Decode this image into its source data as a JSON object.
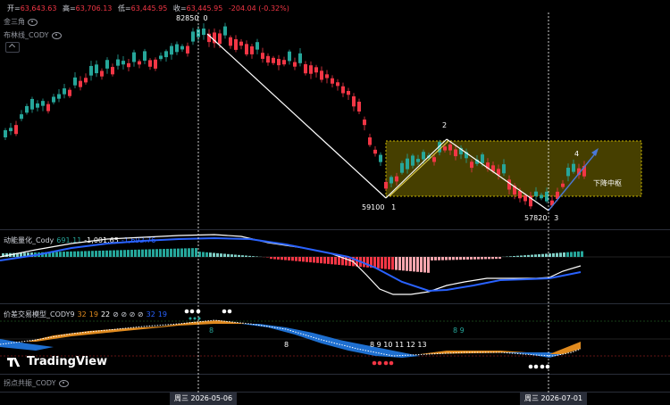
{
  "header": {
    "open_label": "开=",
    "open": "63,643.63",
    "high_label": "高=",
    "high": "63,706.13",
    "low_label": "低=",
    "low": "63,445.95",
    "close_label": "收=",
    "close": "63,445.95",
    "change": "-204.04 (-0.32%)"
  },
  "indicators_main": [
    {
      "name": "金三角"
    },
    {
      "name": "布林线_CODY"
    }
  ],
  "price_annotations": {
    "peak_value": "82850",
    "peak_label": "0",
    "low1_value": "59100",
    "low1_label": "1",
    "p2_label": "2",
    "low3_value": "57820",
    "low3_label": "3",
    "p4_label": "4",
    "zone_label": "下降中枢"
  },
  "momentum": {
    "name": "动能量化_Cody",
    "v1": "691.11",
    "v2": "-1,001.65",
    "v3": "-1,692.76"
  },
  "trade_model": {
    "name": "价差交易模型_CODY9",
    "p1": "32",
    "p2": "19",
    "p3": "22",
    "symbols": "⊘ ⊘ ⊘ ⊘",
    "p4": "32",
    "p5": "19",
    "count_a": "8",
    "count_b": "8 9",
    "count_c": "8",
    "count_d": "8  9 10 11 12 13"
  },
  "resonance": {
    "name": "拐点共振_CODY"
  },
  "logo": {
    "text": "TradingView"
  },
  "dates": {
    "d1": "周三  2026-05-06",
    "d2": "周三  2026-07-01"
  },
  "colors": {
    "up": "#26a69a",
    "down": "#f23645",
    "zone": "#c8b400",
    "blue": "#2962ff",
    "orange": "#e08a1e"
  }
}
